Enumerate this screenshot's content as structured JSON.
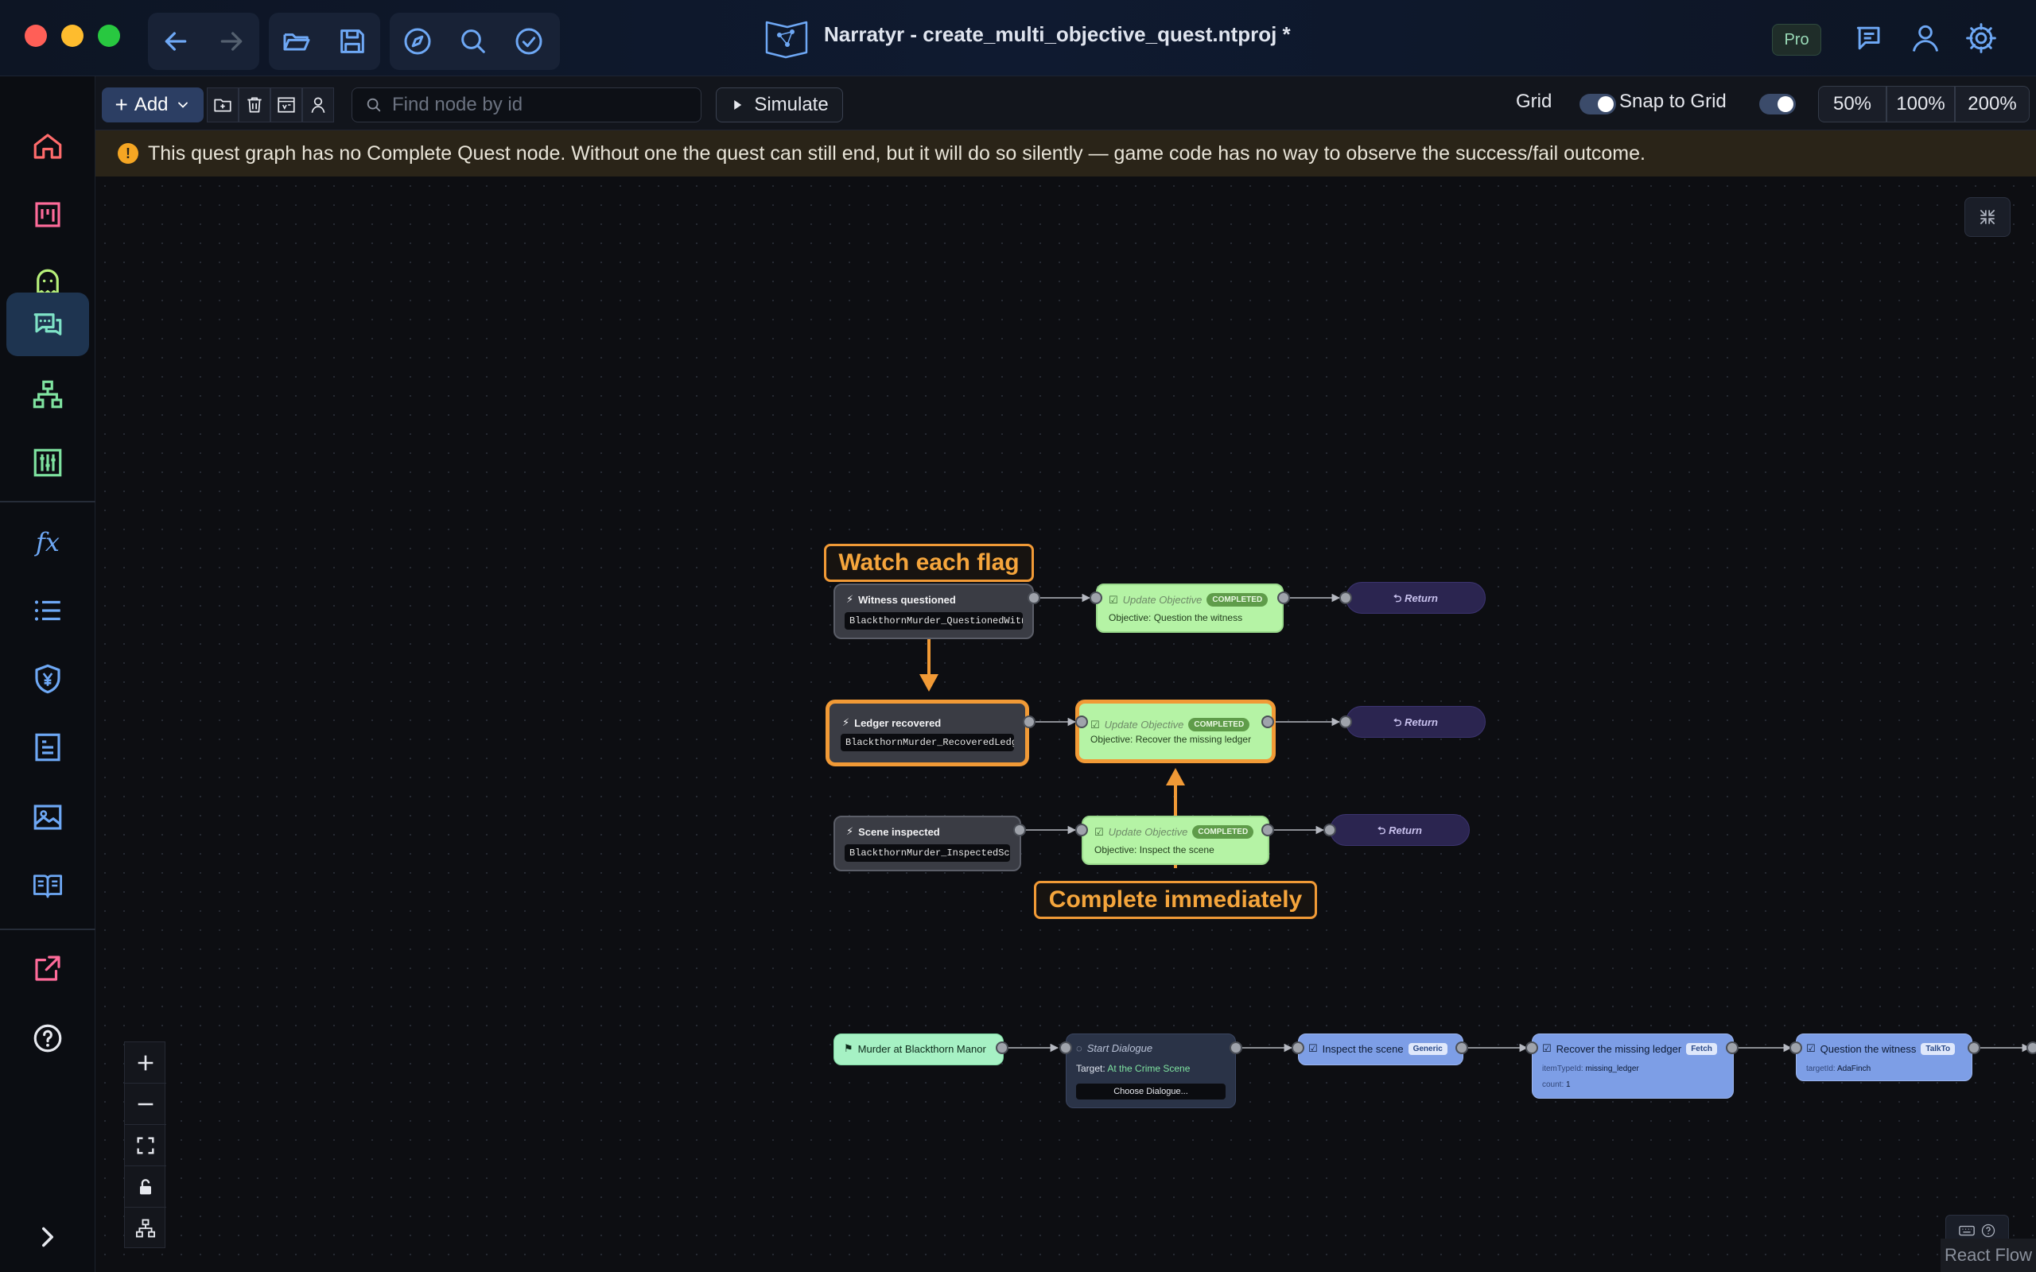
{
  "window": {
    "title": "Narratyr - create_multi_objective_quest.ntproj *",
    "plan_badge": "Pro"
  },
  "toolbar": {
    "add_label": "Add",
    "search_placeholder": "Find node by id",
    "simulate_label": "Simulate",
    "grid_label": "Grid",
    "grid_on": true,
    "snap_label": "Snap to Grid",
    "snap_on": true,
    "zoom_options": [
      "50%",
      "100%",
      "200%"
    ]
  },
  "warning": {
    "icon": "!",
    "text": "This quest graph has no Complete Quest node. Without one the quest can still end, but it will do so silently — game code has no way to observe the success/fail outcome."
  },
  "sidebar": {
    "items": [
      "home-icon",
      "board-icon",
      "ghost-icon",
      "dialogue-icon",
      "hierarchy-icon",
      "sliders-icon",
      "fx-icon",
      "list-icon",
      "currency-shield-icon",
      "form-icon",
      "image-icon",
      "book-icon",
      "export-icon",
      "help-icon"
    ],
    "fx_label": "fx",
    "active": "dialogue-icon"
  },
  "graph": {
    "flags": [
      {
        "title": "Witness questioned",
        "code": "BlackthornMurder_QuestionedWitness"
      },
      {
        "title": "Ledger recovered",
        "code": "BlackthornMurder_RecoveredLedger"
      },
      {
        "title": "Scene inspected",
        "code": "BlackthornMurder_InspectedScene"
      }
    ],
    "objectives": [
      {
        "title": "Update Objective",
        "badge": "COMPLETED",
        "desc": "Objective: Question the witness"
      },
      {
        "title": "Update Objective",
        "badge": "COMPLETED",
        "desc": "Objective: Recover the missing ledger"
      },
      {
        "title": "Update Objective",
        "badge": "COMPLETED",
        "desc": "Objective: Inspect the scene"
      }
    ],
    "return_label": "Return",
    "callouts": {
      "top": "Watch each flag",
      "bottom": "Complete immediately"
    },
    "chain": {
      "start": "Murder at Blackthorn Manor",
      "dialogue": {
        "title": "Start Dialogue",
        "target_label": "Target:",
        "target_value": "At the Crime Scene",
        "button": "Choose Dialogue..."
      },
      "inspect": {
        "title": "Inspect the scene",
        "chip": "Generic"
      },
      "recover": {
        "title": "Recover the missing ledger",
        "chip": "Fetch",
        "field1_key": "itemTypeId:",
        "field1_value": "missing_ledger",
        "field2_key": "count:",
        "field2_value": "1"
      },
      "question": {
        "title": "Question the witness",
        "chip": "TalkTo",
        "field_key": "targetId:",
        "field_value": "AdaFinch"
      }
    }
  },
  "attribution": "React Flow"
}
